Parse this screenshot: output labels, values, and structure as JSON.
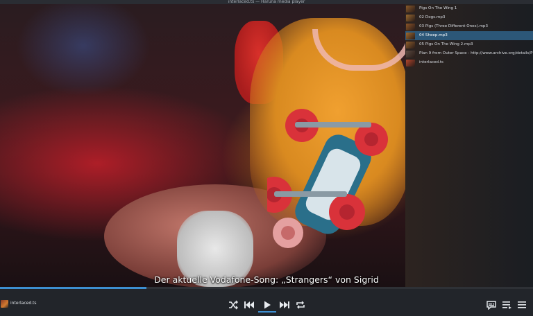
{
  "window": {
    "title": "interlaced.ts — Haruna media player"
  },
  "video": {
    "subtitle": "Der aktuelle Vodafone-Song: „Strangers“ von Sigrid"
  },
  "playlist": {
    "selected_index": 3,
    "items": [
      {
        "title": "Pigs On The Wing 1",
        "thumb": "#8a5a2a"
      },
      {
        "title": "02 Dogs.mp3",
        "thumb": "#9a6a30"
      },
      {
        "title": "03 Pigs (Three Different Ones).mp3",
        "thumb": "#8c5528"
      },
      {
        "title": "04 Sheep.mp3",
        "thumb": "#a06a2e"
      },
      {
        "title": "05 Pigs On The Wing 2.mp3",
        "thumb": "#8e5e2c"
      },
      {
        "title": "Plan 9 from Outer Space - http://www.archive.org/details/Plan_9_from_Outer_Space_1959",
        "thumb": "#5a4a40"
      },
      {
        "title": "interlaced.ts",
        "thumb": "#b4462c"
      }
    ]
  },
  "seek": {
    "progress": 0.275
  },
  "now_playing": {
    "title": "interlaced.ts"
  },
  "controls": {
    "shuffle": "shuffle-icon",
    "previous": "previous-icon",
    "play": "play-icon",
    "next": "next-icon",
    "repeat": "repeat-icon",
    "subtitles": "subtitles-icon",
    "playlist": "playlist-icon",
    "menu": "menu-icon"
  },
  "colors": {
    "accent": "#3d8fd1",
    "selected_row": "#2c5778",
    "control_bar": "#22252a"
  }
}
